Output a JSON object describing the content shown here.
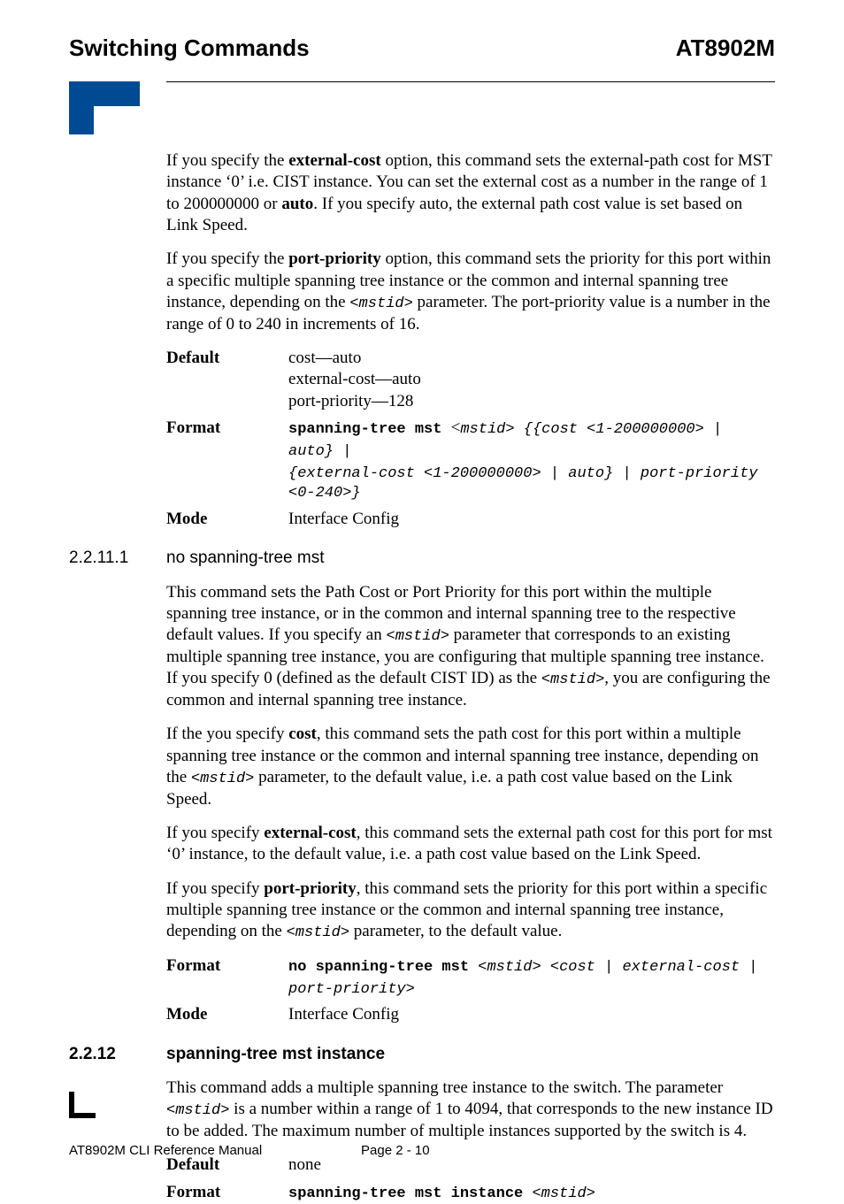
{
  "header": {
    "left": "Switching Commands",
    "right": "AT8902M"
  },
  "intro": {
    "p1_a": "If you specify the ",
    "p1_b": "external-cost",
    "p1_c": " option, this command sets the external-path cost for MST instance ‘0’ i.e. CIST instance. You can set the external cost as a number in the range of 1 to 200000000 or ",
    "p1_d": "auto",
    "p1_e": ". If you specify auto, the external path cost value is set based on Link Speed.",
    "p2_a": "If you specify the ",
    "p2_b": "port-priority",
    "p2_c": " option, this command sets the priority for this port within a specific multiple spanning tree instance or the common and internal spanning tree instance, depending on the ",
    "p2_d": "<mstid>",
    "p2_e": " parameter. The port-priority value is a number in the range of 0 to 240 in increments of 16."
  },
  "dl1": {
    "default_label": "Default",
    "default_l1": "cost—auto",
    "default_l2": "external-cost—auto",
    "default_l3": "port-priority—128",
    "format_label": "Format",
    "format_cmd": "spanning-tree mst ",
    "format_arg1a": "<",
    "format_arg1b": "mstid> {{cost <1-200000000> | auto} | ",
    "format_arg2": "{external-cost <1-200000000> | auto} | port-priority <0-240>}",
    "mode_label": "Mode",
    "mode_val": "Interface Config"
  },
  "sec1": {
    "num": "2.2.11.1",
    "title": "no spanning-tree mst",
    "p1_a": "This command sets the Path Cost or Port Priority for this port within the multiple spanning tree instance, or in the common and internal spanning tree to the respective default values. If you specify an ",
    "p1_b": "<mstid>",
    "p1_c": " parameter that corresponds to an existing multiple spanning tree instance, you are configuring that multiple spanning tree instance. If you specify 0 (defined as the default CIST ID) as the ",
    "p1_d": "<mstid>",
    "p1_e": ", you are configuring the common and internal spanning tree instance.",
    "p2_a": "If the you specify ",
    "p2_b": "cost",
    "p2_c": ", this command sets the path cost for this port within a multiple spanning tree instance or the common and internal spanning tree instance, depending on the ",
    "p2_d": "<mstid>",
    "p2_e": " parameter, to the default value, i.e. a path cost value based on the Link Speed.",
    "p3_a": "If you specify ",
    "p3_b": "external-cost",
    "p3_c": ", this command sets the external path cost for this port for mst ‘0’ instance, to the default value, i.e. a path cost value based on the Link Speed.",
    "p4_a": "If you specify ",
    "p4_b": "port-priority",
    "p4_c": ", this command sets the priority for this port within a specific multiple spanning tree instance or the common and internal spanning tree instance, depending on the ",
    "p4_d": "<mstid>",
    "p4_e": " parameter, to the default value.",
    "format_label": "Format",
    "format_cmd": "no spanning-tree mst ",
    "format_args": "<mstid> <cost | external-cost | port-priority>",
    "mode_label": "Mode",
    "mode_val": "Interface Config"
  },
  "sec2": {
    "num": "2.2.12",
    "title": "spanning-tree mst instance",
    "p1_a": "This command adds a multiple spanning tree instance to the switch. The parameter ",
    "p1_b": "<mstid>",
    "p1_c": " is a number within a range of 1 to 4094, that corresponds to the new instance ID to be added. The maximum number of multiple instances supported by the switch is 4.",
    "default_label": "Default",
    "default_val": "none",
    "format_label": "Format",
    "format_cmd": "spanning-tree mst instance ",
    "format_args": "<mstid>"
  },
  "footer": {
    "left": "AT8902M CLI Reference Manual",
    "center": "Page 2 - 10"
  }
}
